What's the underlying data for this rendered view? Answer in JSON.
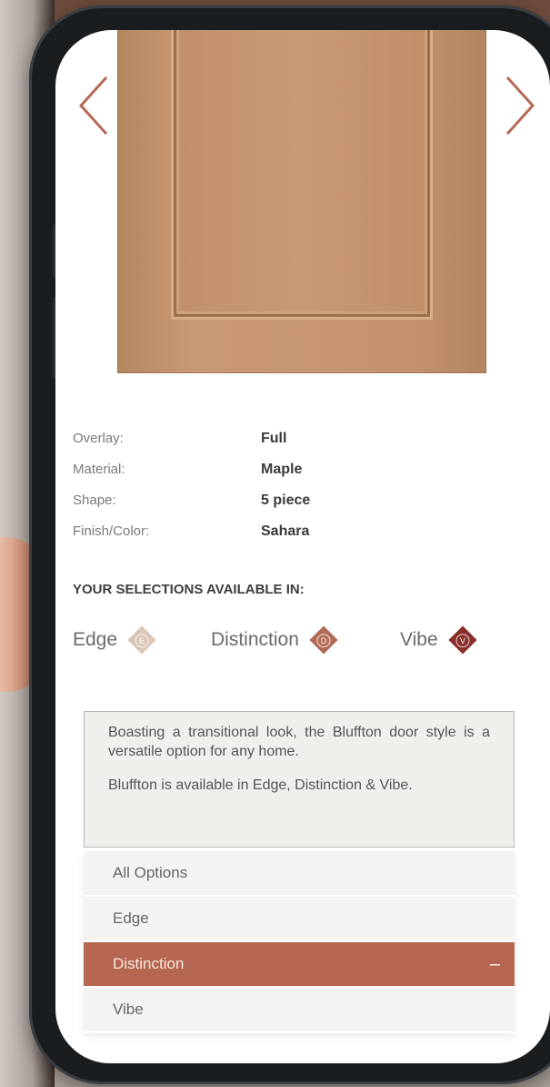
{
  "product": {
    "image_name": "door-image"
  },
  "nav": {
    "prev_icon": "chevron-left-icon",
    "next_icon": "chevron-right-icon"
  },
  "specs": [
    {
      "label": "Overlay:",
      "value": "Full"
    },
    {
      "label": "Material:",
      "value": "Maple"
    },
    {
      "label": "Shape:",
      "value": "5 piece"
    },
    {
      "label": "Finish/Color:",
      "value": "Sahara"
    }
  ],
  "selections": {
    "title": "YOUR SELECTIONS AVAILABLE IN:",
    "lines": [
      {
        "label": "Edge",
        "badge": "E",
        "color": "#d9c6b6"
      },
      {
        "label": "Distinction",
        "badge": "D",
        "color": "#b06a55"
      },
      {
        "label": "Vibe",
        "badge": "V",
        "color": "#8a2e2a"
      }
    ]
  },
  "description": {
    "p1": "Boasting a transitional look, the Bluffton door style is a versatile option for any home.",
    "p2": "Bluffton is available in Edge, Distinction & Vibe."
  },
  "options": [
    {
      "label": "All Options",
      "active": false
    },
    {
      "label": "Edge",
      "active": false
    },
    {
      "label": "Distinction",
      "active": true,
      "toggle": "–"
    },
    {
      "label": "Vibe",
      "active": false
    }
  ],
  "colors": {
    "accent": "#b66650",
    "arrow": "#b46a55"
  }
}
